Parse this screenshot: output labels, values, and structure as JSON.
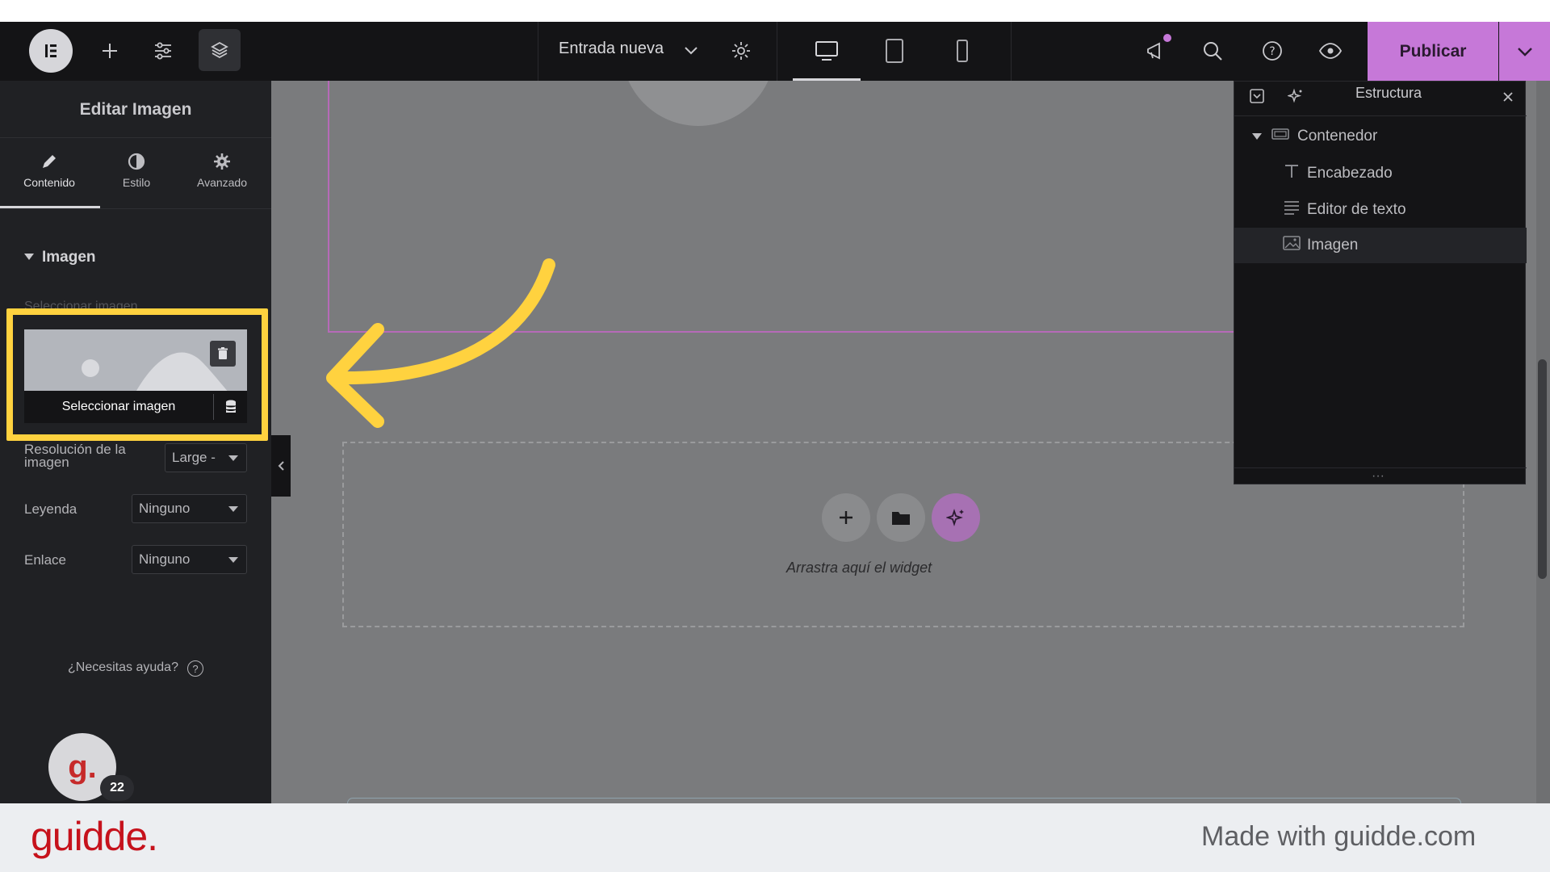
{
  "topbar": {
    "doc_title": "Entrada nueva",
    "publish_label": "Publicar"
  },
  "panel": {
    "title": "Editar Imagen",
    "tabs": [
      {
        "label": "Contenido"
      },
      {
        "label": "Estilo"
      },
      {
        "label": "Avanzado"
      }
    ],
    "section_title": "Imagen",
    "select_image_label": "Seleccionar imagen",
    "select_image_button": "Seleccionar imagen",
    "fields": {
      "resolution_label": "Resolución de la imagen",
      "resolution_value": "Large - ",
      "caption_label": "Leyenda",
      "caption_value": "Ninguno",
      "link_label": "Enlace",
      "link_value": "Ninguno"
    },
    "help_text": "¿Necesitas ayuda?",
    "avatar_letter": "g.",
    "avatar_badge": "22"
  },
  "canvas": {
    "dropzone_text": "Arrastra aquí el widget"
  },
  "structure": {
    "title": "Estructura",
    "items": [
      {
        "label": "Contenedor"
      },
      {
        "label": "Encabezado"
      },
      {
        "label": "Editor de texto"
      },
      {
        "label": "Imagen"
      }
    ]
  },
  "footer": {
    "brand": "guidde.",
    "made_with": "Made with guidde.com"
  },
  "colors": {
    "accent": "#c678d8",
    "highlight": "#ffd23f",
    "brand": "#c6121c"
  }
}
